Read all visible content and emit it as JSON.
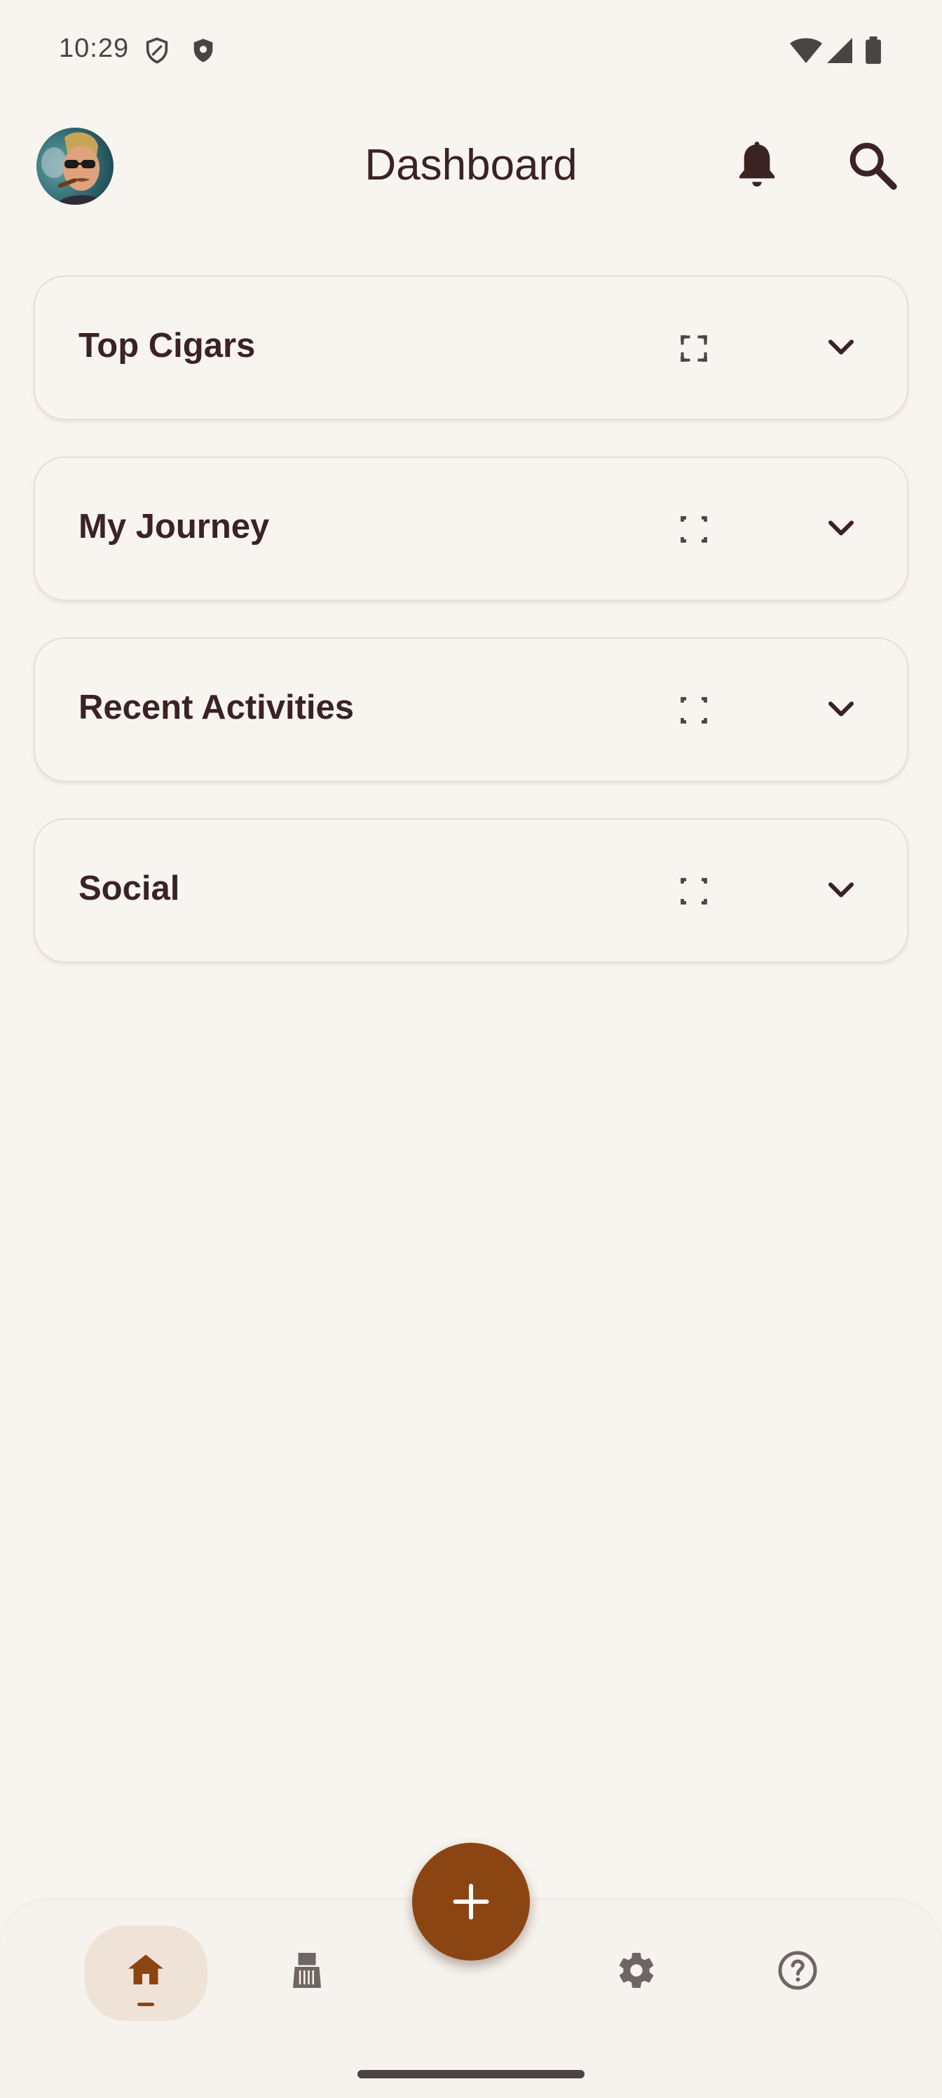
{
  "status_bar": {
    "time": "10:29",
    "icons": [
      "shield-outline-icon",
      "shield-filled-icon",
      "wifi-icon",
      "cellular-icon",
      "battery-icon"
    ]
  },
  "app_bar": {
    "title": "Dashboard",
    "avatar": "user-avatar",
    "actions": [
      "bell-icon",
      "search-icon"
    ]
  },
  "cards": [
    {
      "title": "Top Cigars"
    },
    {
      "title": "My Journey"
    },
    {
      "title": "Recent Activities"
    },
    {
      "title": "Social"
    }
  ],
  "fab": {
    "icon": "plus-icon"
  },
  "bottom_nav": {
    "items": [
      {
        "icon": "home-icon",
        "active": true
      },
      {
        "icon": "humidor-icon",
        "active": false
      },
      {
        "icon": "gear-icon",
        "active": false
      },
      {
        "icon": "help-circle-icon",
        "active": false
      }
    ]
  },
  "colors": {
    "background": "#f8f5f1",
    "accent": "#8b4513",
    "text": "#3b2323",
    "active_nav_pill": "#efe3d8"
  }
}
